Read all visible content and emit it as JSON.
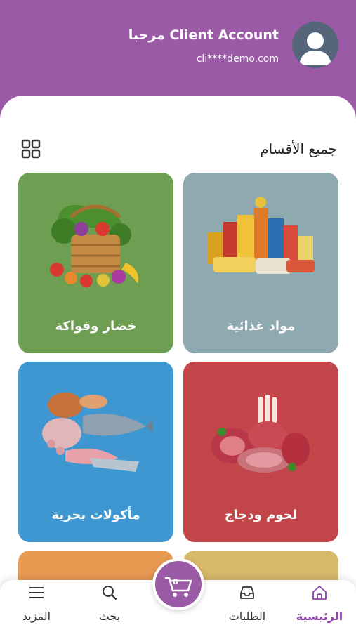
{
  "header": {
    "greeting": "مرحبا Client Account",
    "email": "cli****demo.com"
  },
  "section": {
    "title": "جميع الأقسام"
  },
  "categories": [
    {
      "label": "مواد غذائية",
      "color": "#8fa9b0"
    },
    {
      "label": "خضار وفواكة",
      "color": "#6e9e52"
    },
    {
      "label": "لحوم ودجاج",
      "color": "#c2454a"
    },
    {
      "label": "مأكولات بحرية",
      "color": "#3f97d2"
    }
  ],
  "cart": {
    "count": "0"
  },
  "nav": {
    "home": "الرئيسية",
    "orders": "الطلبات",
    "search": "بحث",
    "more": "المزيد"
  },
  "colors": {
    "primary": "#9b5aa5",
    "active_nav": "#8e44ad"
  }
}
